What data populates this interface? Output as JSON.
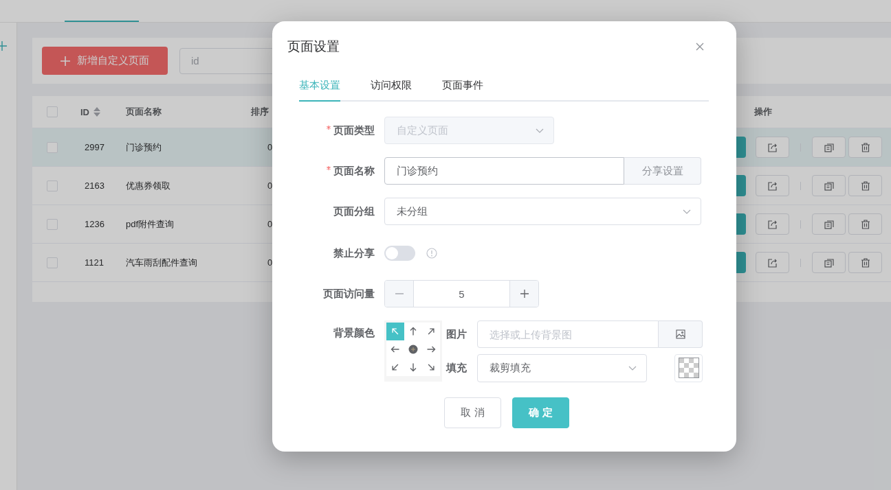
{
  "toolbar": {
    "add_button": "新增自定义页面",
    "search": {
      "placeholder": "id"
    }
  },
  "table": {
    "columns": [
      {
        "label": "ID",
        "sortable": true
      },
      {
        "label": "页面名称",
        "sortable": false
      },
      {
        "label": "排序",
        "sortable": false
      },
      {
        "label": "操作",
        "sortable": false
      }
    ],
    "header_checked": false,
    "rows": [
      {
        "id": "2997",
        "name": "门诊预约",
        "sort": "0",
        "selected": true,
        "checked": false
      },
      {
        "id": "2163",
        "name": "优惠券领取",
        "sort": "0",
        "selected": false,
        "checked": false
      },
      {
        "id": "1236",
        "name": "pdf附件查询",
        "sort": "0",
        "selected": false,
        "checked": false
      },
      {
        "id": "1121",
        "name": "汽车雨刮配件查询",
        "sort": "0",
        "selected": false,
        "checked": false
      }
    ]
  },
  "dialog": {
    "title": "页面设置",
    "tabs": [
      {
        "label": "基本设置",
        "selected": true
      },
      {
        "label": "访问权限",
        "selected": false
      },
      {
        "label": "页面事件",
        "selected": false
      }
    ],
    "fields": [
      {
        "kind": "select",
        "label": "页面类型",
        "required": true,
        "value": "自定义页面",
        "disabled": true
      },
      {
        "kind": "input_append",
        "label": "页面名称",
        "required": true,
        "value": "门诊预约",
        "append": "分享设置"
      },
      {
        "kind": "select",
        "label": "页面分组",
        "required": false,
        "value": "未分组",
        "disabled": false
      },
      {
        "kind": "switch",
        "label": "禁止分享",
        "required": false,
        "on": false
      },
      {
        "kind": "number",
        "label": "页面访问量",
        "required": false,
        "value": "5"
      },
      {
        "kind": "background",
        "label": "背景颜色",
        "required": false,
        "positions": [
          {
            "selected": true
          },
          {
            "selected": false
          },
          {
            "selected": false
          },
          {
            "selected": false
          },
          {
            "selected": false
          },
          {
            "selected": false
          },
          {
            "selected": false
          },
          {
            "selected": false
          },
          {
            "selected": false
          }
        ],
        "image_label": "图片",
        "image_placeholder": "选择或上传背景图",
        "fill_label": "填充",
        "fill_value": "裁剪填充"
      }
    ],
    "buttons": [
      {
        "label": "取 消",
        "kind": "default"
      },
      {
        "label": "确 定",
        "kind": "primary"
      }
    ]
  }
}
